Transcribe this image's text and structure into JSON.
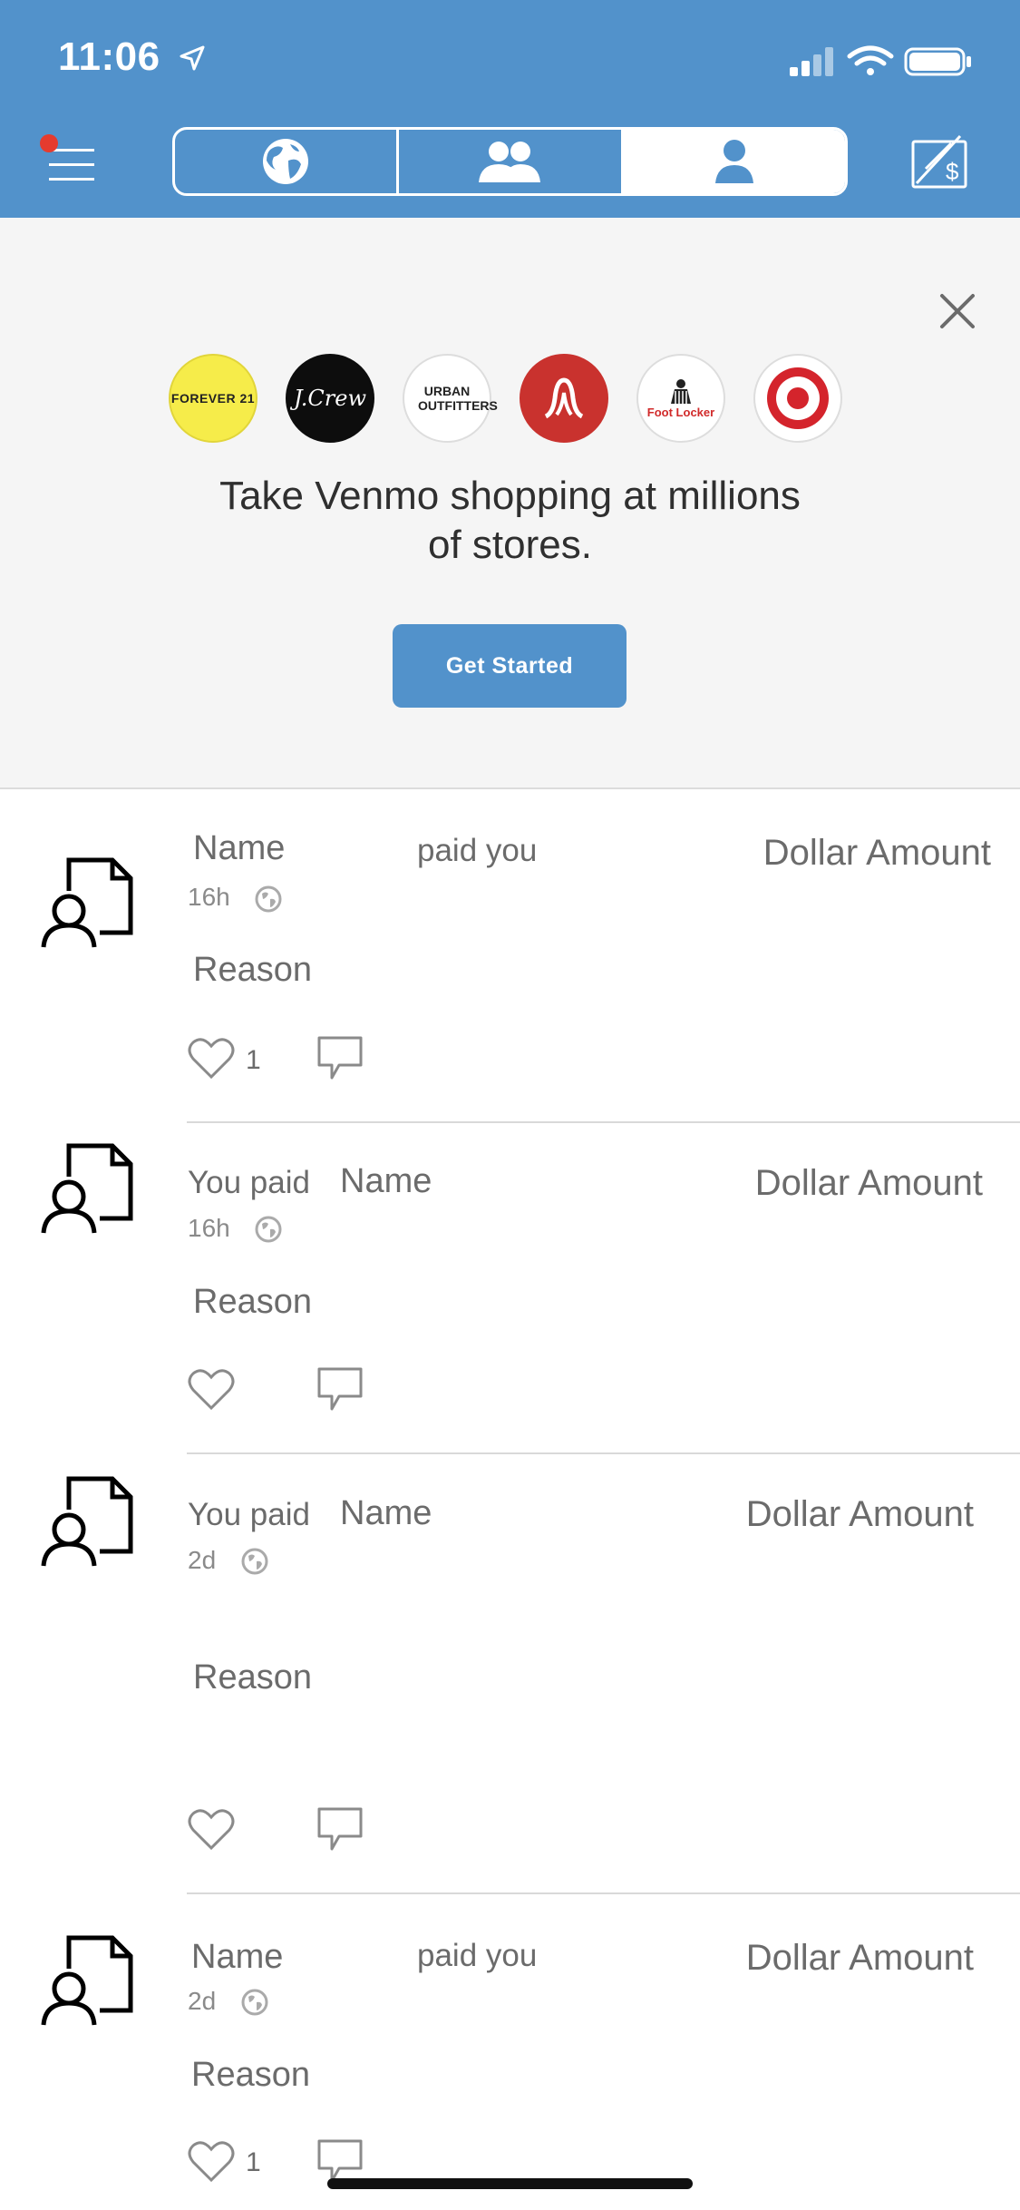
{
  "status_bar": {
    "time": "11:06"
  },
  "header": {
    "tabs": [
      {
        "name": "globe",
        "icon": "globe-icon"
      },
      {
        "name": "friends",
        "icon": "friends-icon"
      },
      {
        "name": "me",
        "icon": "person-icon"
      }
    ],
    "colors": {
      "brand": "#5292cb",
      "notification_dot": "#e53b2e"
    }
  },
  "promo": {
    "logos": [
      {
        "id": "forever21",
        "text": "FOREVER 21"
      },
      {
        "id": "jcrew",
        "text": "J.Crew"
      },
      {
        "id": "urban-outfitters",
        "text": "URBAN OUTFITTERS"
      },
      {
        "id": "lululemon",
        "icon": "lululemon-icon"
      },
      {
        "id": "foot-locker",
        "text": "Foot Locker"
      },
      {
        "id": "target",
        "icon": "target-icon"
      }
    ],
    "headline": "Take Venmo shopping at millions of stores.",
    "headline_line1": "Take Venmo shopping at millions",
    "headline_line2": "of stores.",
    "button_label": "Get Started"
  },
  "feed": [
    {
      "name": "Name",
      "action": "paid you",
      "amount": "Dollar Amount",
      "time": "16h",
      "reason": "Reason",
      "likes": "1"
    },
    {
      "prefix": "You paid",
      "name": "Name",
      "amount": "Dollar Amount",
      "time": "16h",
      "reason": "Reason",
      "likes": ""
    },
    {
      "prefix": "You paid",
      "name": "Name",
      "amount": "Dollar Amount",
      "time": "2d",
      "reason": "Reason",
      "likes": ""
    },
    {
      "name": "Name",
      "action": "paid you",
      "amount": "Dollar Amount",
      "time": "2d",
      "reason": "Reason",
      "likes": "1"
    }
  ]
}
